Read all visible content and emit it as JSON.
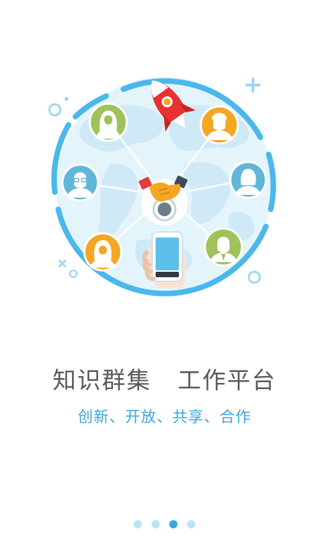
{
  "onboarding": {
    "headline": "知识群集   工作平台",
    "subtitle": "创新、开放、共享、合作",
    "current_page": 3,
    "total_pages": 4
  },
  "illustration": {
    "elements": [
      "world-map",
      "rocket-icon",
      "handshake-icon",
      "smartphone-icon",
      "user-avatars"
    ]
  },
  "colors": {
    "primary": "#3aa6de",
    "ring": "#4ab8ea",
    "globe": "#e4f4fb",
    "headline_text": "#5a5a5a",
    "dot_inactive": "#b9e3f7"
  }
}
